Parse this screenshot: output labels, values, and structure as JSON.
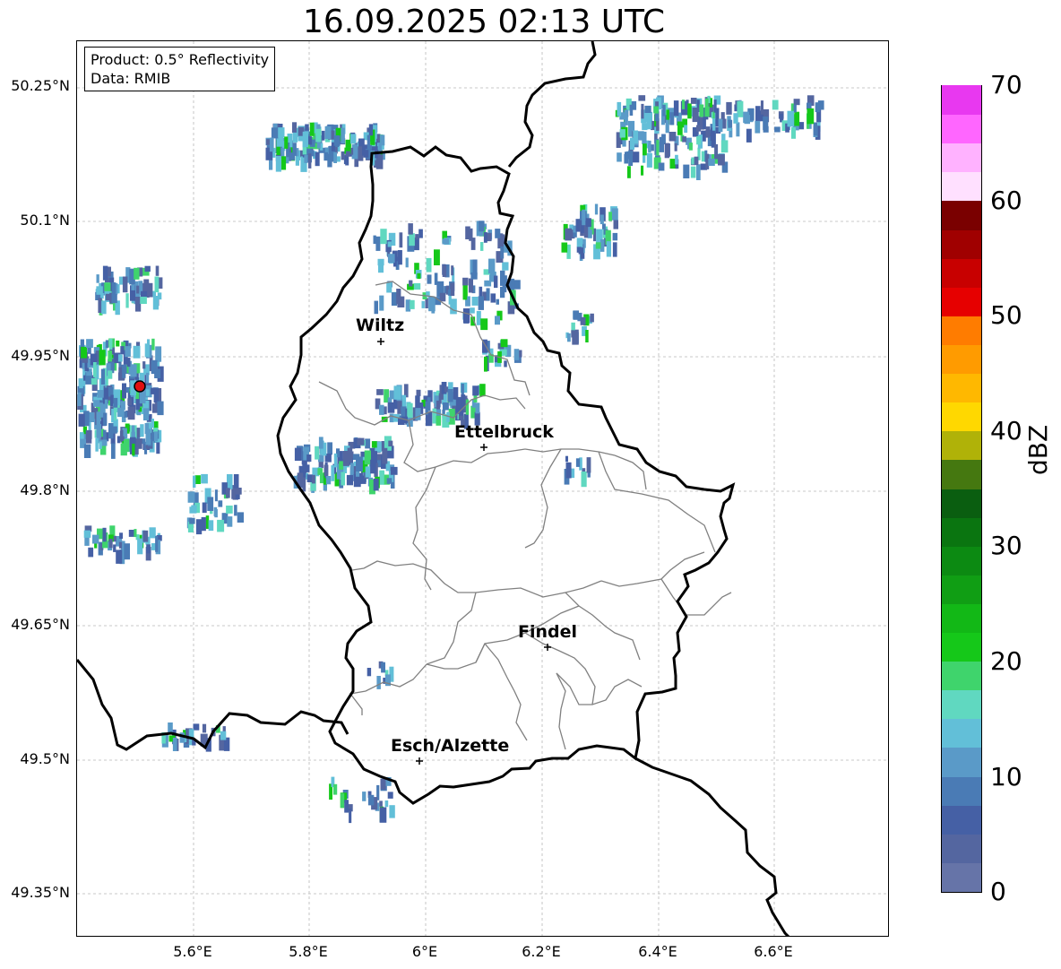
{
  "title": "16.09.2025 02:13 UTC",
  "legend": {
    "product": "Product: 0.5° Reflectivity",
    "data": "Data: RMIB"
  },
  "axes": {
    "lat_ticks": [
      "50.25°N",
      "50.1°N",
      "49.95°N",
      "49.8°N",
      "49.65°N",
      "49.5°N",
      "49.35°N"
    ],
    "lon_ticks": [
      "5.6°E",
      "5.8°E",
      "6°E",
      "6.2°E",
      "6.4°E",
      "6.6°E"
    ]
  },
  "cities": [
    {
      "name": "Wiltz"
    },
    {
      "name": "Ettelbruck"
    },
    {
      "name": "Findel"
    },
    {
      "name": "Esch/Alzette"
    }
  ],
  "colorbar": {
    "label": "dBZ",
    "ticks": [
      "0",
      "10",
      "20",
      "30",
      "40",
      "50",
      "60",
      "70"
    ],
    "colors": [
      "#6674a8",
      "#5466a0",
      "#4560a5",
      "#4a7bb5",
      "#5a9ac8",
      "#62bfd8",
      "#60d8c0",
      "#3fd46c",
      "#15c819",
      "#12b816",
      "#109e14",
      "#0c8a12",
      "#0a7510",
      "#0a5e10",
      "#457810",
      "#b0b208",
      "#ffd800",
      "#ffb800",
      "#ff9b00",
      "#ff7c00",
      "#e60000",
      "#c80000",
      "#a00000",
      "#7a0000",
      "#ffe0ff",
      "#ffb2ff",
      "#ff66ff",
      "#e838f0"
    ]
  },
  "colors": {
    "border": "#000000",
    "canton": "#808080",
    "grid": "#b8b8b8",
    "radar_site": "#e01010"
  }
}
